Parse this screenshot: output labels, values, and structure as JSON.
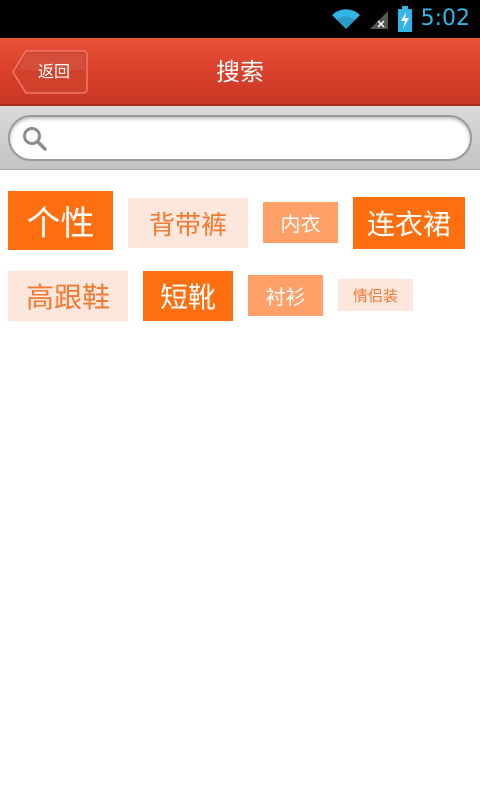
{
  "status_bar": {
    "time": "5:02",
    "icons": [
      "wifi-icon",
      "signal-icon",
      "battery-charging-icon"
    ],
    "accent_color": "#33b5e5"
  },
  "header": {
    "back_label": "返回",
    "title": "搜索",
    "background_color": "#d8402b"
  },
  "search": {
    "value": "",
    "placeholder": "",
    "icon": "search-icon"
  },
  "hot_tags": [
    {
      "label": "个性",
      "style": "dark"
    },
    {
      "label": "背带裤",
      "style": "pale"
    },
    {
      "label": "内衣",
      "style": "light"
    },
    {
      "label": "连衣裙",
      "style": "dark"
    },
    {
      "label": "高跟鞋",
      "style": "pale"
    },
    {
      "label": "短靴",
      "style": "dark"
    },
    {
      "label": "衬衫",
      "style": "light"
    },
    {
      "label": "情侣装",
      "style": "pale"
    }
  ],
  "tag_colors": {
    "dark": "#ff6f0f",
    "light": "#ffa068",
    "pale": "#fde6dc",
    "pale_text": "#f07a32",
    "light_text": "#ffffff",
    "dark_text": "#ffffff"
  }
}
